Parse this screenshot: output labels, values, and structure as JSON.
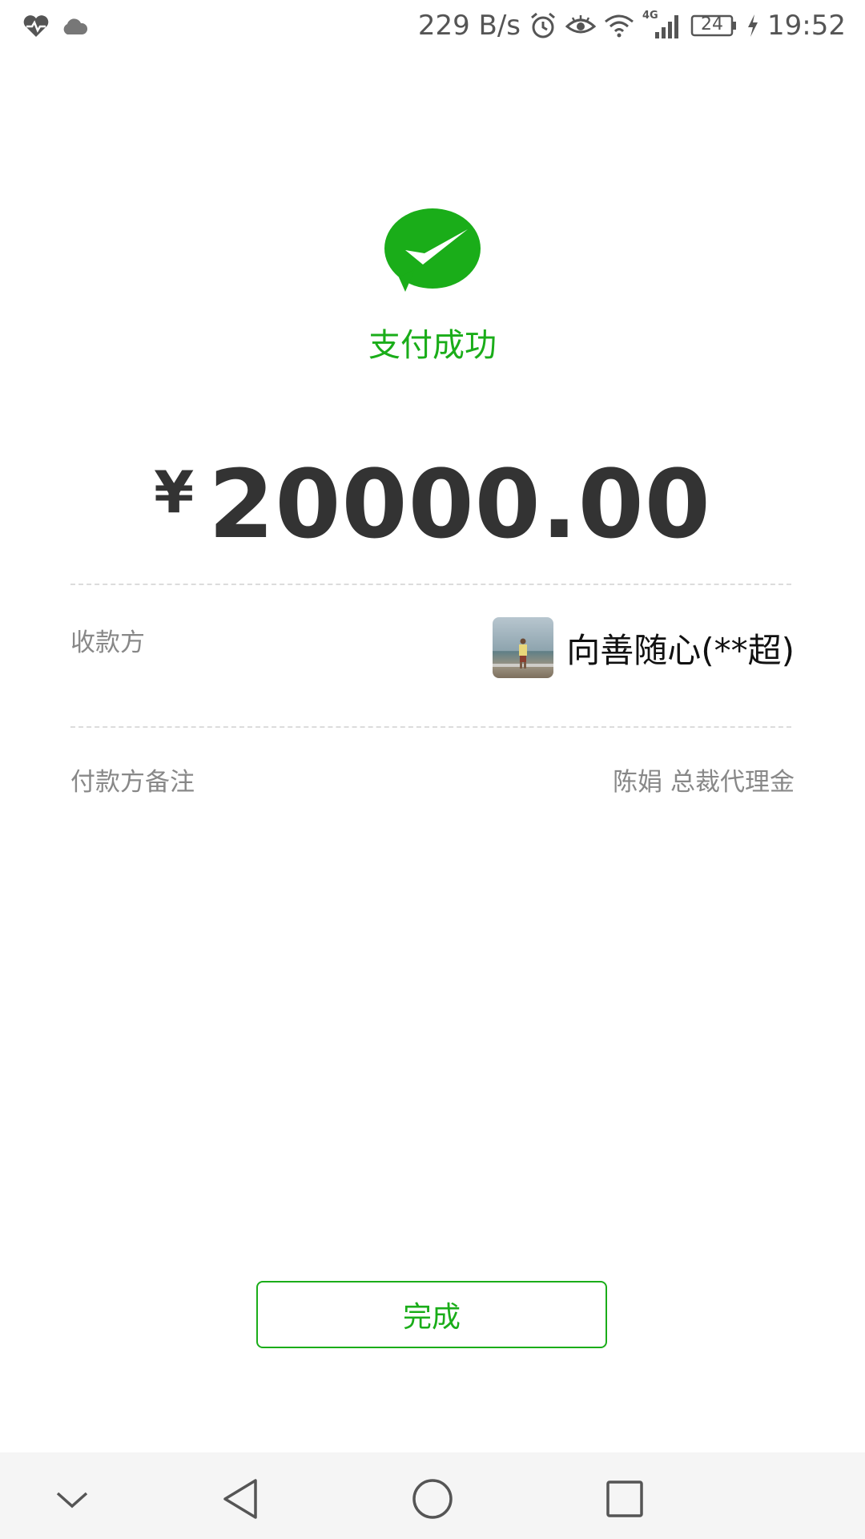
{
  "status_bar": {
    "network_speed": "229 B/s",
    "network_type": "4G",
    "battery": "24",
    "time": "19:52"
  },
  "payment": {
    "status_title": "支付成功",
    "currency_symbol": "¥",
    "amount": "20000.00"
  },
  "details": {
    "payee_label": "收款方",
    "payee_name": "向善随心(**超)",
    "note_label": "付款方备注",
    "note_value": "陈娟 总裁代理金"
  },
  "actions": {
    "done_label": "完成"
  },
  "colors": {
    "brand_green": "#1aad19",
    "text_dark": "#333333",
    "text_muted": "#888888"
  }
}
